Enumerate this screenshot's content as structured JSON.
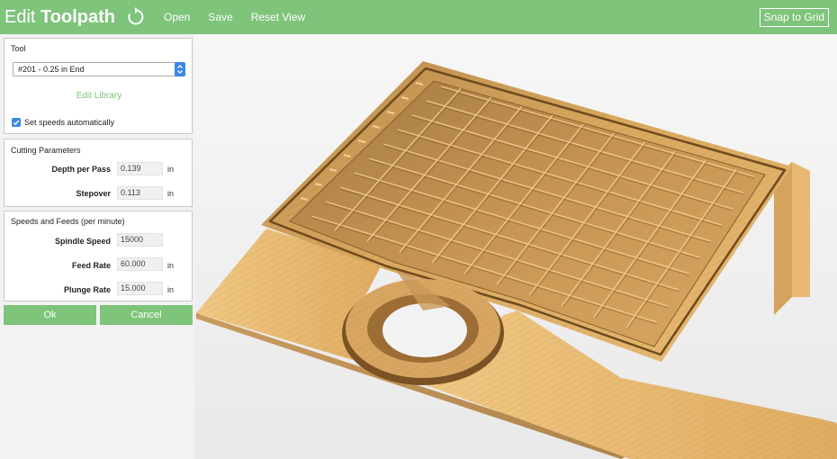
{
  "header": {
    "title_prefix": "Edit",
    "title_bold": "Toolpath",
    "menu": [
      "Open",
      "Save",
      "Reset View"
    ],
    "snap_label": "Snap to Grid"
  },
  "tool": {
    "section_title": "Tool",
    "selected": "#201 - 0.25 in End",
    "edit_library": "Edit Library",
    "auto_speeds_label": "Set speeds automatically",
    "auto_speeds_checked": true
  },
  "cutting": {
    "section_title": "Cutting Parameters",
    "depth_label": "Depth per Pass",
    "depth_value": "0.139",
    "depth_unit": "in",
    "stepover_label": "Stepover",
    "stepover_value": "0.113",
    "stepover_unit": "in"
  },
  "speeds": {
    "section_title": "Speeds and Feeds (per minute)",
    "spindle_label": "Spindle Speed",
    "spindle_value": "15000",
    "feed_label": "Feed Rate",
    "feed_value": "60.000",
    "feed_unit": "in",
    "plunge_label": "Plunge Rate",
    "plunge_value": "15.000",
    "plunge_unit": "in"
  },
  "actions": {
    "ok_label": "Ok",
    "cancel_label": "Cancel"
  },
  "colors": {
    "accent": "#7ec47a",
    "checkbox": "#3b87e8",
    "wood": "#e3b46b"
  },
  "icons": {
    "undo": "rotate-icon",
    "select_arrow": "updown-chevron-icon",
    "check": "check-icon"
  }
}
